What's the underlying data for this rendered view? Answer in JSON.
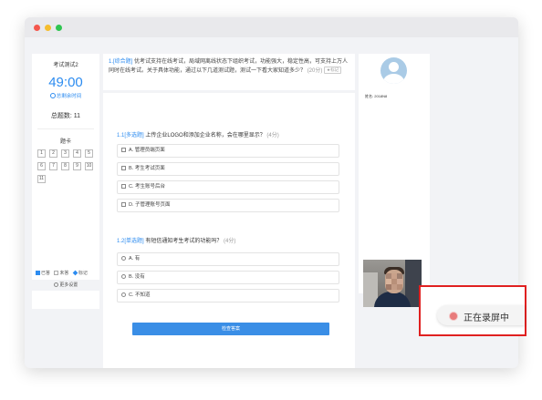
{
  "window": {
    "controls": [
      "close",
      "minimize",
      "zoom"
    ]
  },
  "left_panel": {
    "exam_name": "考试测试2",
    "timer": "49:00",
    "remaining_label": "总剩余时间",
    "total_questions": "总题数: 11",
    "answer_sheet_title": "题卡",
    "question_numbers": [
      "1",
      "2",
      "3",
      "4",
      "5",
      "6",
      "7",
      "8",
      "9",
      "10",
      "11"
    ],
    "legend": {
      "answered": "已答",
      "unanswered": "未答",
      "marked": "标记"
    },
    "more_settings": "更多设置"
  },
  "question_header": {
    "number": "1.",
    "type": "[综合题]",
    "text": "优考试支持在线考试，局域网离线状态下组织考试，功能强大，稳定性高，可支持上万人同时在线考试。关于具体功能，通过以下几道测试题，测试一下看大家知道多少？",
    "score": "(20分)",
    "mark_label": "标记"
  },
  "sub_questions": [
    {
      "number": "1.1",
      "type": "[多选题]",
      "text": "上传企业LOGO和添加企业名称，会在哪里显示？",
      "score": "(4分)",
      "options": [
        "A. 管理员端页面",
        "B. 考生考试页面",
        "C. 考生账号后台",
        "D. 子管理账号页面"
      ]
    },
    {
      "number": "1.2",
      "type": "[单选题]",
      "text": "有短信通知考生考试的功能吗？",
      "score": "(4分)",
      "options": [
        "A. 有",
        "B. 没有",
        "C. 不知道"
      ]
    }
  ],
  "submit_label": "检查答案",
  "right_panel": {
    "name_prefix": "姓名:",
    "name_value": "2018N8"
  },
  "recording": {
    "label": "正在录屏中"
  },
  "colors": {
    "accent": "#2d8cf0",
    "recording_border": "#e02020",
    "background": "#f2f3f6"
  }
}
